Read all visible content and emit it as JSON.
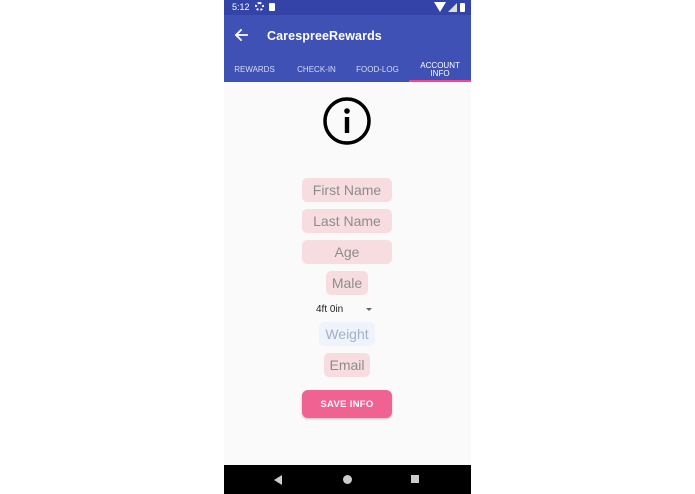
{
  "status_bar": {
    "time": "5:12"
  },
  "app_bar": {
    "title": "CarespreeRewards"
  },
  "tabs": [
    {
      "label": "REWARDS"
    },
    {
      "label": "CHECK-IN"
    },
    {
      "label": "FOOD-LOG"
    },
    {
      "label": "ACCOUNT INFO",
      "active": true
    }
  ],
  "form": {
    "first_name": "First Name",
    "last_name": "Last Name",
    "age": "Age",
    "gender": "Male",
    "height_selected": "4ft 0in",
    "weight": "Weight",
    "email": "Email"
  },
  "save_button": {
    "label": "SAVE INFO"
  },
  "colors": {
    "primary": "#3f51b5",
    "status": "#3443a8",
    "accent": "#ff4081",
    "button": "#f06292",
    "field": "#f8dde0"
  }
}
